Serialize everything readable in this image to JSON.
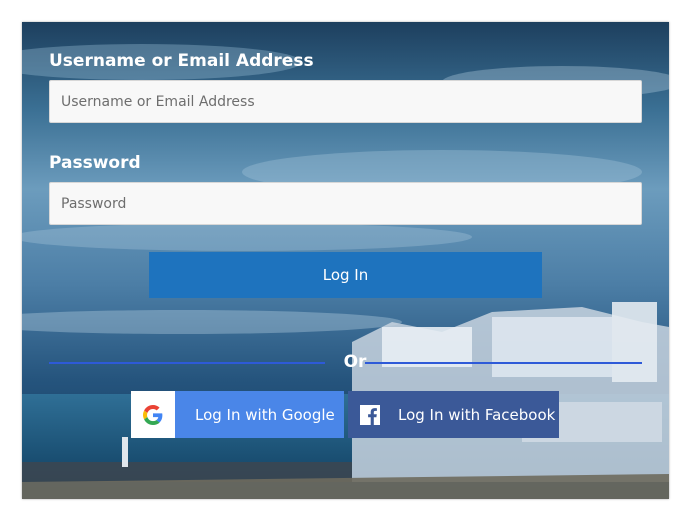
{
  "form": {
    "username_label": "Username or Email Address",
    "username_placeholder": "Username or Email Address",
    "username_value": "",
    "password_label": "Password",
    "password_placeholder": "Password",
    "password_value": "",
    "login_label": "Log In",
    "or_label": "Or",
    "google_label": "Log In with Google",
    "facebook_label": "Log In with Facebook"
  },
  "icons": {
    "google": "google-icon",
    "facebook": "facebook-icon"
  },
  "colors": {
    "login_button": "#1e73be",
    "divider": "#2e5ad8",
    "google_button": "#4a86e8",
    "facebook_button": "#3b5998"
  }
}
